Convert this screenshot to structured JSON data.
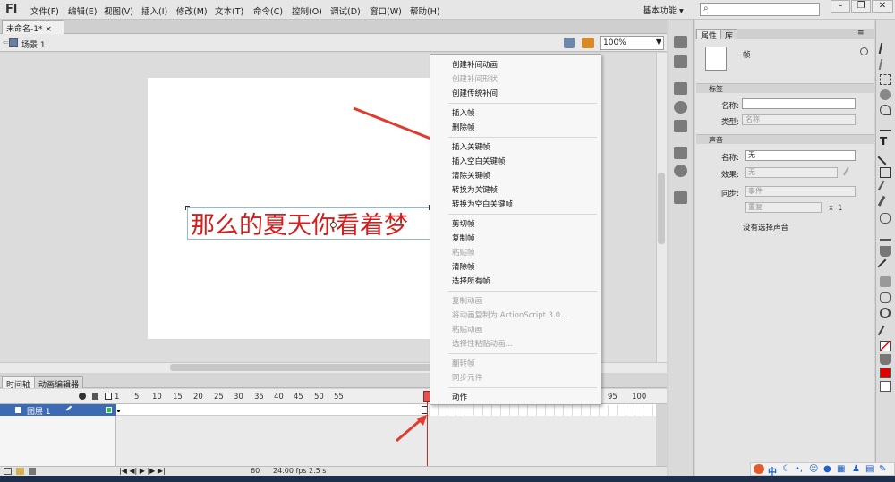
{
  "app": {
    "logo": "Fl"
  },
  "menu": [
    "文件(F)",
    "编辑(E)",
    "视图(V)",
    "插入(I)",
    "修改(M)",
    "文本(T)",
    "命令(C)",
    "控制(O)",
    "调试(D)",
    "窗口(W)",
    "帮助(H)"
  ],
  "workspace": {
    "label": "基本功能",
    "search_icon": "⌕"
  },
  "window_buttons": [
    "–",
    "❐",
    "✕"
  ],
  "document": {
    "tab": "未命名-1*",
    "tab_close": "×"
  },
  "editbar": {
    "scene": "场景 1",
    "zoom": "100%"
  },
  "stage": {
    "text": "那么的夏天你看着梦"
  },
  "context_menu": [
    {
      "label": "创建补间动画",
      "enabled": true
    },
    {
      "label": "创建补间形状",
      "enabled": false
    },
    {
      "label": "创建传统补间",
      "enabled": true
    },
    {
      "label": "插入帧",
      "enabled": true
    },
    {
      "label": "删除帧",
      "enabled": true
    },
    {
      "label": "插入关键帧",
      "enabled": true
    },
    {
      "label": "插入空白关键帧",
      "enabled": true
    },
    {
      "label": "清除关键帧",
      "enabled": true
    },
    {
      "label": "转换为关键帧",
      "enabled": true
    },
    {
      "label": "转换为空白关键帧",
      "enabled": true
    },
    {
      "label": "剪切帧",
      "enabled": true
    },
    {
      "label": "复制帧",
      "enabled": true
    },
    {
      "label": "粘贴帧",
      "enabled": false
    },
    {
      "label": "清除帧",
      "enabled": true
    },
    {
      "label": "选择所有帧",
      "enabled": true
    },
    {
      "label": "复制动画",
      "enabled": false
    },
    {
      "label": "将动画复制为 ActionScript 3.0...",
      "enabled": false
    },
    {
      "label": "粘贴动画",
      "enabled": false
    },
    {
      "label": "选择性粘贴动画...",
      "enabled": false
    },
    {
      "label": "翻转帧",
      "enabled": false
    },
    {
      "label": "同步元件",
      "enabled": false
    },
    {
      "label": "动作",
      "enabled": true
    }
  ],
  "timeline": {
    "tabs": [
      "时间轴",
      "动画编辑器"
    ],
    "frame_numbers": [
      "1",
      "5",
      "10",
      "15",
      "20",
      "25",
      "30",
      "35",
      "40",
      "45",
      "50",
      "55",
      "95",
      "100"
    ],
    "layer": "图层 1",
    "status": {
      "frame": "60",
      "fps": "24.00 fps",
      "time": "2.5 s"
    }
  },
  "properties": {
    "tabs": [
      "属性",
      "库"
    ],
    "object": "帧",
    "label_section": "标签",
    "name_label": "名称:",
    "type_label": "类型:",
    "type_value": "名称",
    "sound_section": "声音",
    "sound_name_label": "名称:",
    "sound_name_value": "无",
    "effect_label": "效果:",
    "effect_value": "无",
    "sync_label": "同步:",
    "sync_value": "事件",
    "repeat_value": "重复",
    "repeat_count": "1",
    "repeat_x": "x",
    "no_sound": "没有选择声音"
  },
  "tray": {
    "ime": "中"
  },
  "colors": {
    "stage_text": "#d01f1f",
    "layer_selected": "#3d6bb3",
    "playhead": "#e02020",
    "fill_color": "#e00000"
  }
}
